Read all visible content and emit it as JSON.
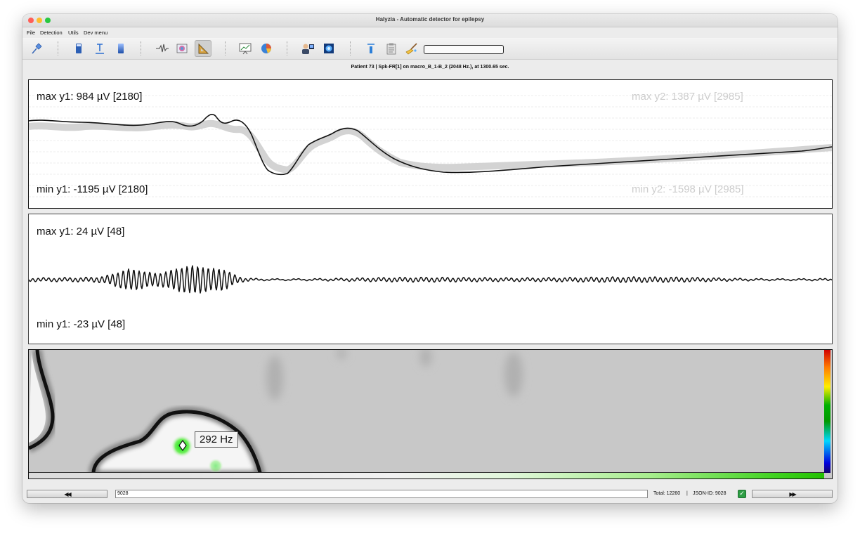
{
  "window": {
    "title": "Halyzia - Automatic detector for epilepsy"
  },
  "menu": {
    "items": [
      {
        "label": "File"
      },
      {
        "label": "Detection"
      },
      {
        "label": "Utils"
      },
      {
        "label": "Dev menu"
      }
    ]
  },
  "toolbar": {
    "buttons": [
      {
        "icon": "pin-icon"
      },
      {
        "icon": "blue-bar-icon"
      },
      {
        "icon": "text-cursor-icon"
      },
      {
        "icon": "blue-gradient-bar-icon"
      },
      {
        "icon": "waveform-icon"
      },
      {
        "icon": "brain-scan-icon"
      },
      {
        "icon": "ruler-triangle-icon",
        "pressed": true
      },
      {
        "icon": "chart-presentation-icon"
      },
      {
        "icon": "pie-chart-icon"
      },
      {
        "icon": "doctor-computer-icon"
      },
      {
        "icon": "head-scan-icon"
      },
      {
        "icon": "filter-info-icon"
      },
      {
        "icon": "clipboard-icon"
      },
      {
        "icon": "broom-icon"
      }
    ]
  },
  "info_bar": {
    "text": "Patient 73   |   Spk-FR[1] on macro_B_1-B_2 (2048 Hz.), at 1300.65 sec."
  },
  "panel_raw": {
    "max_y1": "max y1: 984 µV [2180]",
    "min_y1": "min y1: -1195 µV [2180]",
    "max_y2": "max y2: 1387 µV [2985]",
    "min_y2": "min y2: -1598 µV [2985]"
  },
  "panel_filtered": {
    "max_y1": "max y1: 24 µV [48]",
    "min_y1": "min y1: -23 µV [48]"
  },
  "panel_tf": {
    "freq_marker": "292 Hz"
  },
  "bottom": {
    "prev_label": "◀◀",
    "next_label": "▶▶",
    "id_value": "9028",
    "total": "Total: 12260",
    "separator": "|",
    "json_id": "JSON-ID: 9028",
    "checkbox_mark": "✓"
  },
  "colors": {
    "accent_green": "#22c000",
    "checkbox_green": "#2e9e44"
  }
}
